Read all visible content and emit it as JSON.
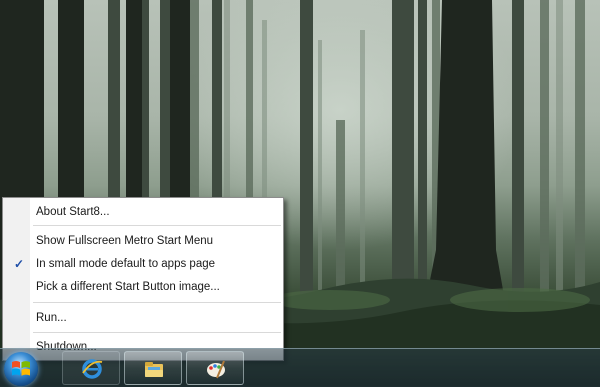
{
  "menu": {
    "items": [
      {
        "label": "About Start8...",
        "checked": false
      },
      {
        "label": "Show Fullscreen Metro Start Menu",
        "checked": false
      },
      {
        "label": "In small mode default to apps page",
        "checked": true
      },
      {
        "label": "Pick a different Start Button image...",
        "checked": false
      },
      {
        "label": "Run...",
        "checked": false
      },
      {
        "label": "Shutdown...",
        "checked": false
      }
    ],
    "check_glyph": "✓"
  },
  "taskbar": {
    "start_button_icon": "windows-logo-icon",
    "buttons": [
      {
        "icon": "internet-explorer-icon"
      },
      {
        "icon": "file-explorer-icon"
      },
      {
        "icon": "paint-icon"
      }
    ]
  },
  "colors": {
    "menu_background": "#ffffff",
    "menu_gutter": "#f1f1f1",
    "check_color": "#1f4fa8",
    "taskbar": "#1e3038"
  }
}
